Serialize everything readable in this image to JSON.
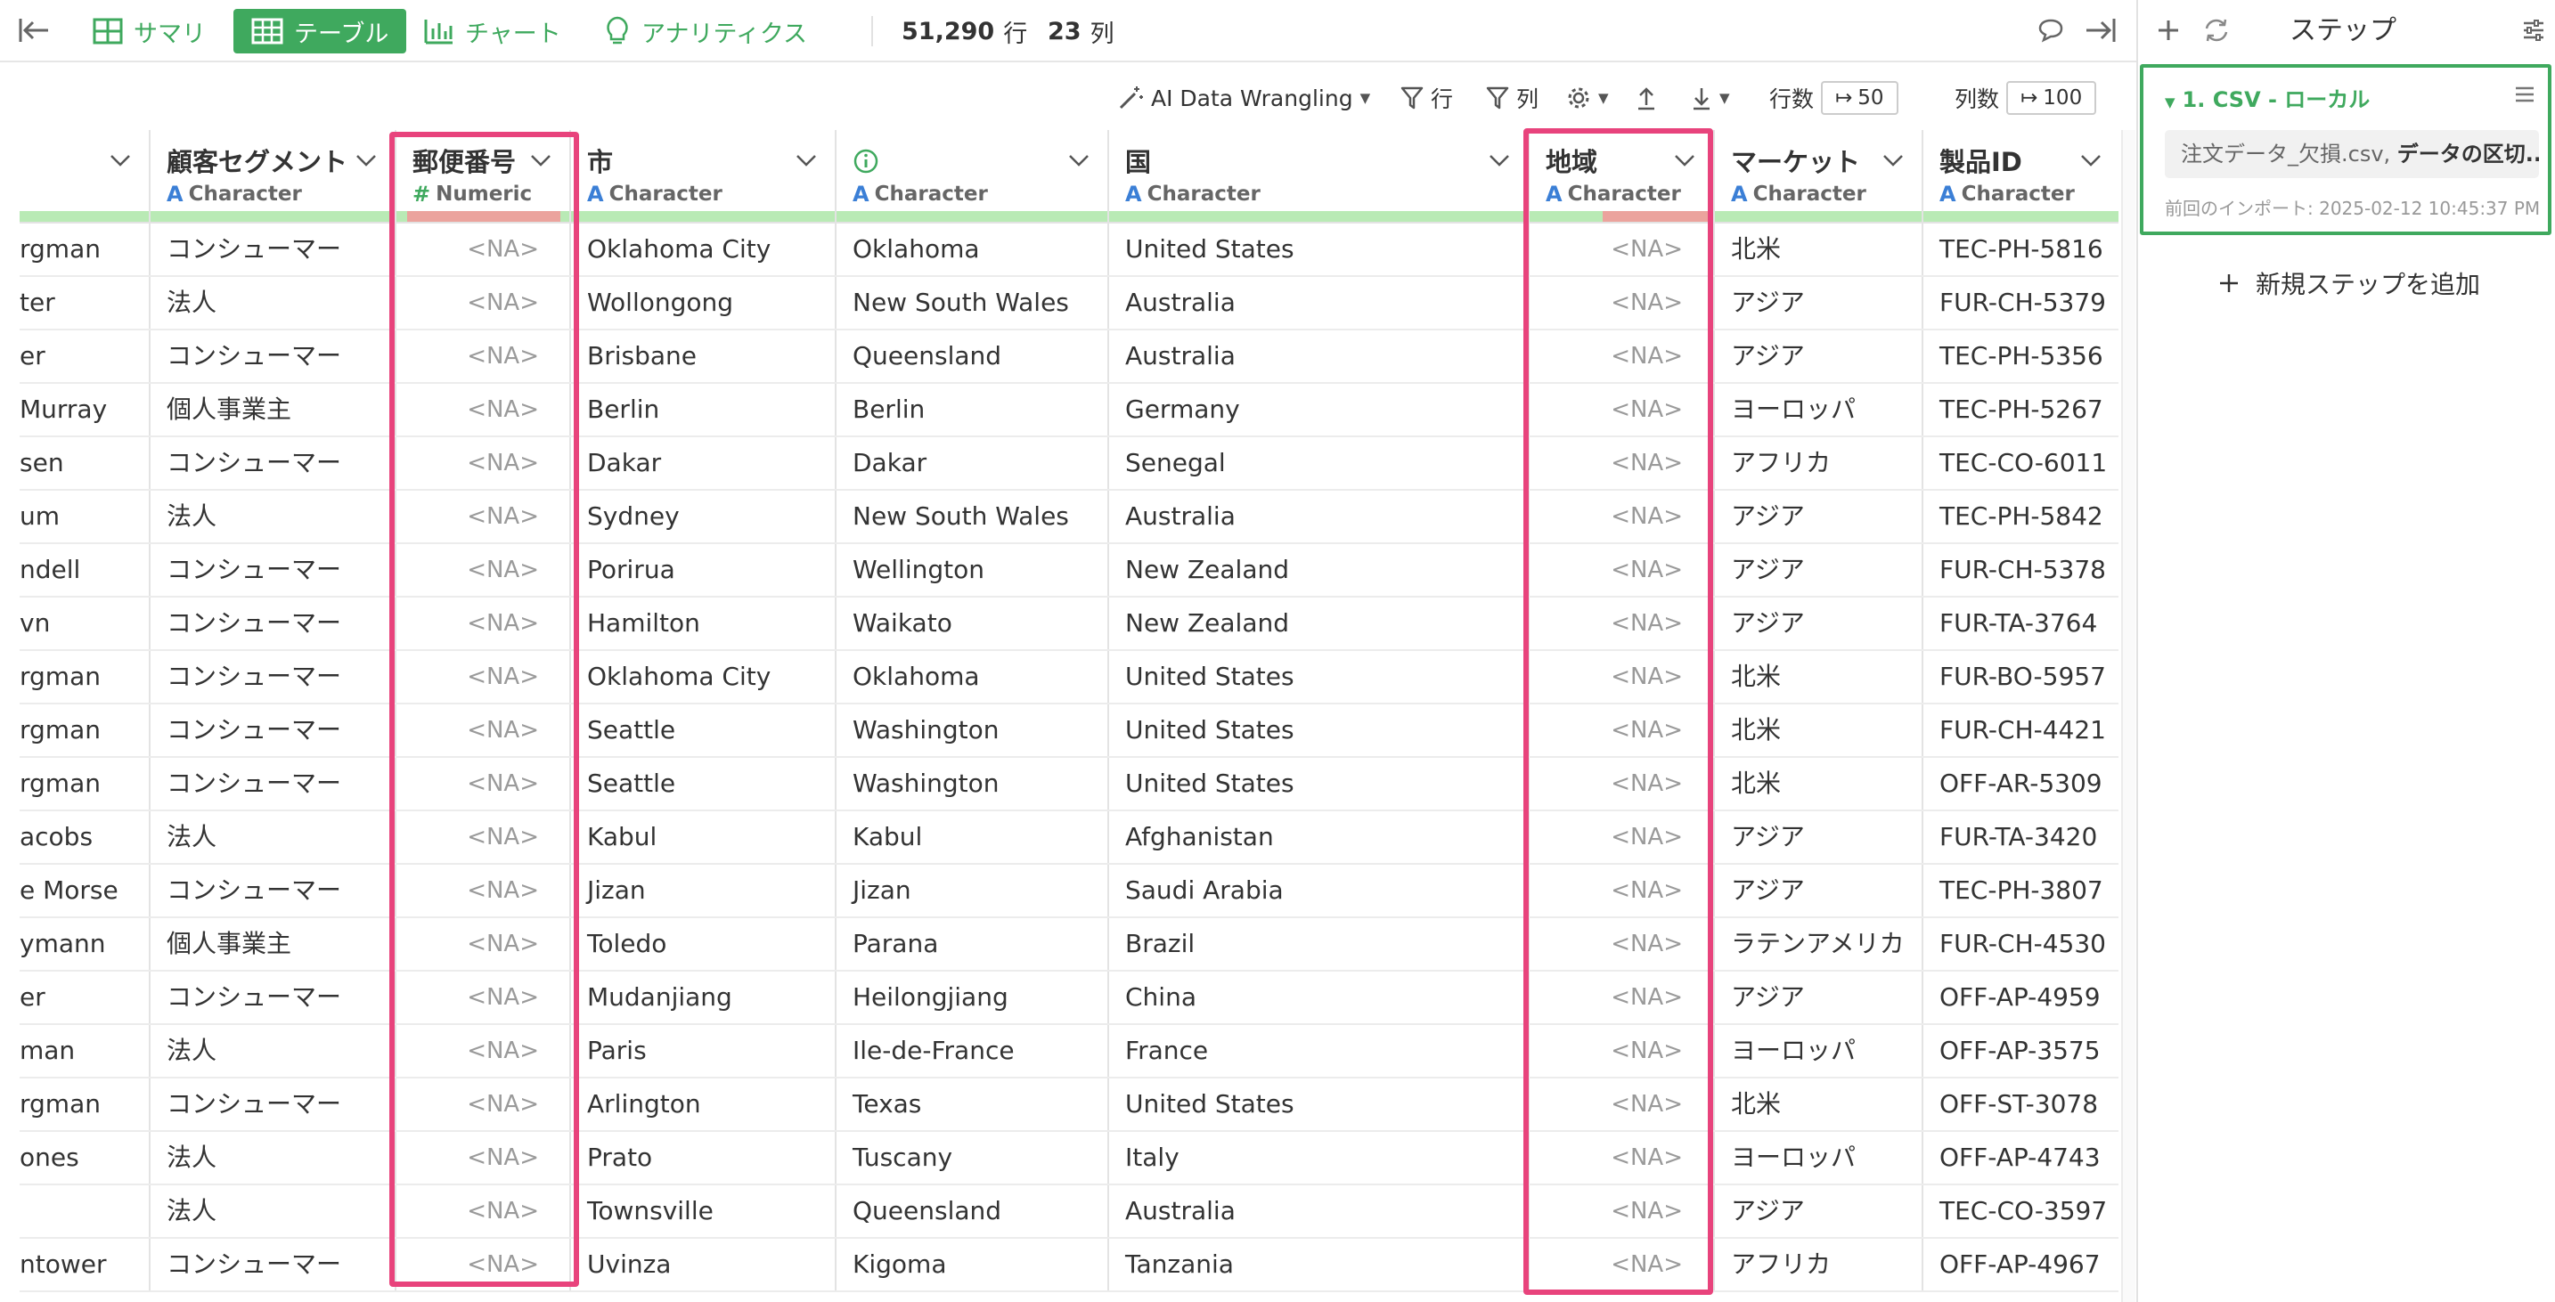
{
  "toolbar": {
    "summary": "サマリ",
    "table": "テーブル",
    "chart": "チャート",
    "analytics": "アナリティクス",
    "rows_value": "51,290",
    "rows_unit": "行",
    "cols_value": "23",
    "cols_unit": "列"
  },
  "subbar": {
    "ai": "AI Data Wrangling",
    "row_filter": "行",
    "col_filter": "列",
    "rows_label": "行数",
    "rows_value": "50",
    "cols_label": "列数",
    "cols_value": "100"
  },
  "grid": {
    "columns": [
      {
        "name": "",
        "type": ""
      },
      {
        "name": "顧客セグメント",
        "type": "Character",
        "na_fraction": 0
      },
      {
        "name": "郵便番号",
        "type": "Numeric",
        "na_fraction": 1
      },
      {
        "name": "市",
        "type": "Character",
        "na_fraction": 0
      },
      {
        "name": "",
        "type": "Character",
        "na_fraction": 0
      },
      {
        "name": "国",
        "type": "Character",
        "na_fraction": 0
      },
      {
        "name": "地域",
        "type": "Character",
        "na_fraction": 0.6
      },
      {
        "name": "マーケット",
        "type": "Character",
        "na_fraction": 0
      },
      {
        "name": "製品ID",
        "type": "Character",
        "na_fraction": 0
      }
    ],
    "rows": [
      [
        "rgman",
        "コンシューマー",
        "<NA>",
        "Oklahoma City",
        "Oklahoma",
        "United States",
        "<NA>",
        "北米",
        "TEC-PH-5816"
      ],
      [
        "ter",
        "法人",
        "<NA>",
        "Wollongong",
        "New South Wales",
        "Australia",
        "<NA>",
        "アジア",
        "FUR-CH-5379"
      ],
      [
        "er",
        "コンシューマー",
        "<NA>",
        "Brisbane",
        "Queensland",
        "Australia",
        "<NA>",
        "アジア",
        "TEC-PH-5356"
      ],
      [
        " Murray",
        "個人事業主",
        "<NA>",
        "Berlin",
        "Berlin",
        "Germany",
        "<NA>",
        "ヨーロッパ",
        "TEC-PH-5267"
      ],
      [
        "sen",
        "コンシューマー",
        "<NA>",
        "Dakar",
        "Dakar",
        "Senegal",
        "<NA>",
        "アフリカ",
        "TEC-CO-6011"
      ],
      [
        "um",
        "法人",
        "<NA>",
        "Sydney",
        "New South Wales",
        "Australia",
        "<NA>",
        "アジア",
        "TEC-PH-5842"
      ],
      [
        "ndell",
        "コンシューマー",
        "<NA>",
        "Porirua",
        "Wellington",
        "New Zealand",
        "<NA>",
        "アジア",
        "FUR-CH-5378"
      ],
      [
        "vn",
        "コンシューマー",
        "<NA>",
        "Hamilton",
        "Waikato",
        "New Zealand",
        "<NA>",
        "アジア",
        "FUR-TA-3764"
      ],
      [
        "rgman",
        "コンシューマー",
        "<NA>",
        "Oklahoma City",
        "Oklahoma",
        "United States",
        "<NA>",
        "北米",
        "FUR-BO-5957"
      ],
      [
        "rgman",
        "コンシューマー",
        "<NA>",
        "Seattle",
        "Washington",
        "United States",
        "<NA>",
        "北米",
        "FUR-CH-4421"
      ],
      [
        "rgman",
        "コンシューマー",
        "<NA>",
        "Seattle",
        "Washington",
        "United States",
        "<NA>",
        "北米",
        "OFF-AR-5309"
      ],
      [
        "acobs",
        "法人",
        "<NA>",
        "Kabul",
        "Kabul",
        "Afghanistan",
        "<NA>",
        "アジア",
        "FUR-TA-3420"
      ],
      [
        "e Morse",
        "コンシューマー",
        "<NA>",
        "Jizan",
        "Jizan",
        "Saudi Arabia",
        "<NA>",
        "アジア",
        "TEC-PH-3807"
      ],
      [
        "ymann",
        "個人事業主",
        "<NA>",
        "Toledo",
        "Parana",
        "Brazil",
        "<NA>",
        "ラテンアメリカ",
        "FUR-CH-4530"
      ],
      [
        "er",
        "コンシューマー",
        "<NA>",
        "Mudanjiang",
        "Heilongjiang",
        "China",
        "<NA>",
        "アジア",
        "OFF-AP-4959"
      ],
      [
        "man",
        "法人",
        "<NA>",
        "Paris",
        "Ile-de-France",
        "France",
        "<NA>",
        "ヨーロッパ",
        "OFF-AP-3575"
      ],
      [
        "rgman",
        "コンシューマー",
        "<NA>",
        "Arlington",
        "Texas",
        "United States",
        "<NA>",
        "北米",
        "OFF-ST-3078"
      ],
      [
        "ones",
        "法人",
        "<NA>",
        "Prato",
        "Tuscany",
        "Italy",
        "<NA>",
        "ヨーロッパ",
        "OFF-AP-4743"
      ],
      [
        "",
        "法人",
        "<NA>",
        "Townsville",
        "Queensland",
        "Australia",
        "<NA>",
        "アジア",
        "TEC-CO-3597"
      ],
      [
        "ntower",
        "コンシューマー",
        "<NA>",
        "Uvinza",
        "Kigoma",
        "Tanzania",
        "<NA>",
        "アフリカ",
        "OFF-AP-4967"
      ]
    ]
  },
  "steps_panel": {
    "title": "ステップ",
    "step_title": "1. CSV - ローカル",
    "file_name": "注文データ_欠損.csv, ",
    "file_desc": "データの区切...",
    "last_import": "前回のインポート: 2025-02-12 10:45:37 PM",
    "add_step": "新規ステップを追加"
  },
  "colors": {
    "accent": "#3fa95e",
    "highlight": "#e8437c",
    "type_character": "#3b7fd6",
    "quality_ok": "#b9eab5",
    "quality_na": "#eba39d"
  }
}
